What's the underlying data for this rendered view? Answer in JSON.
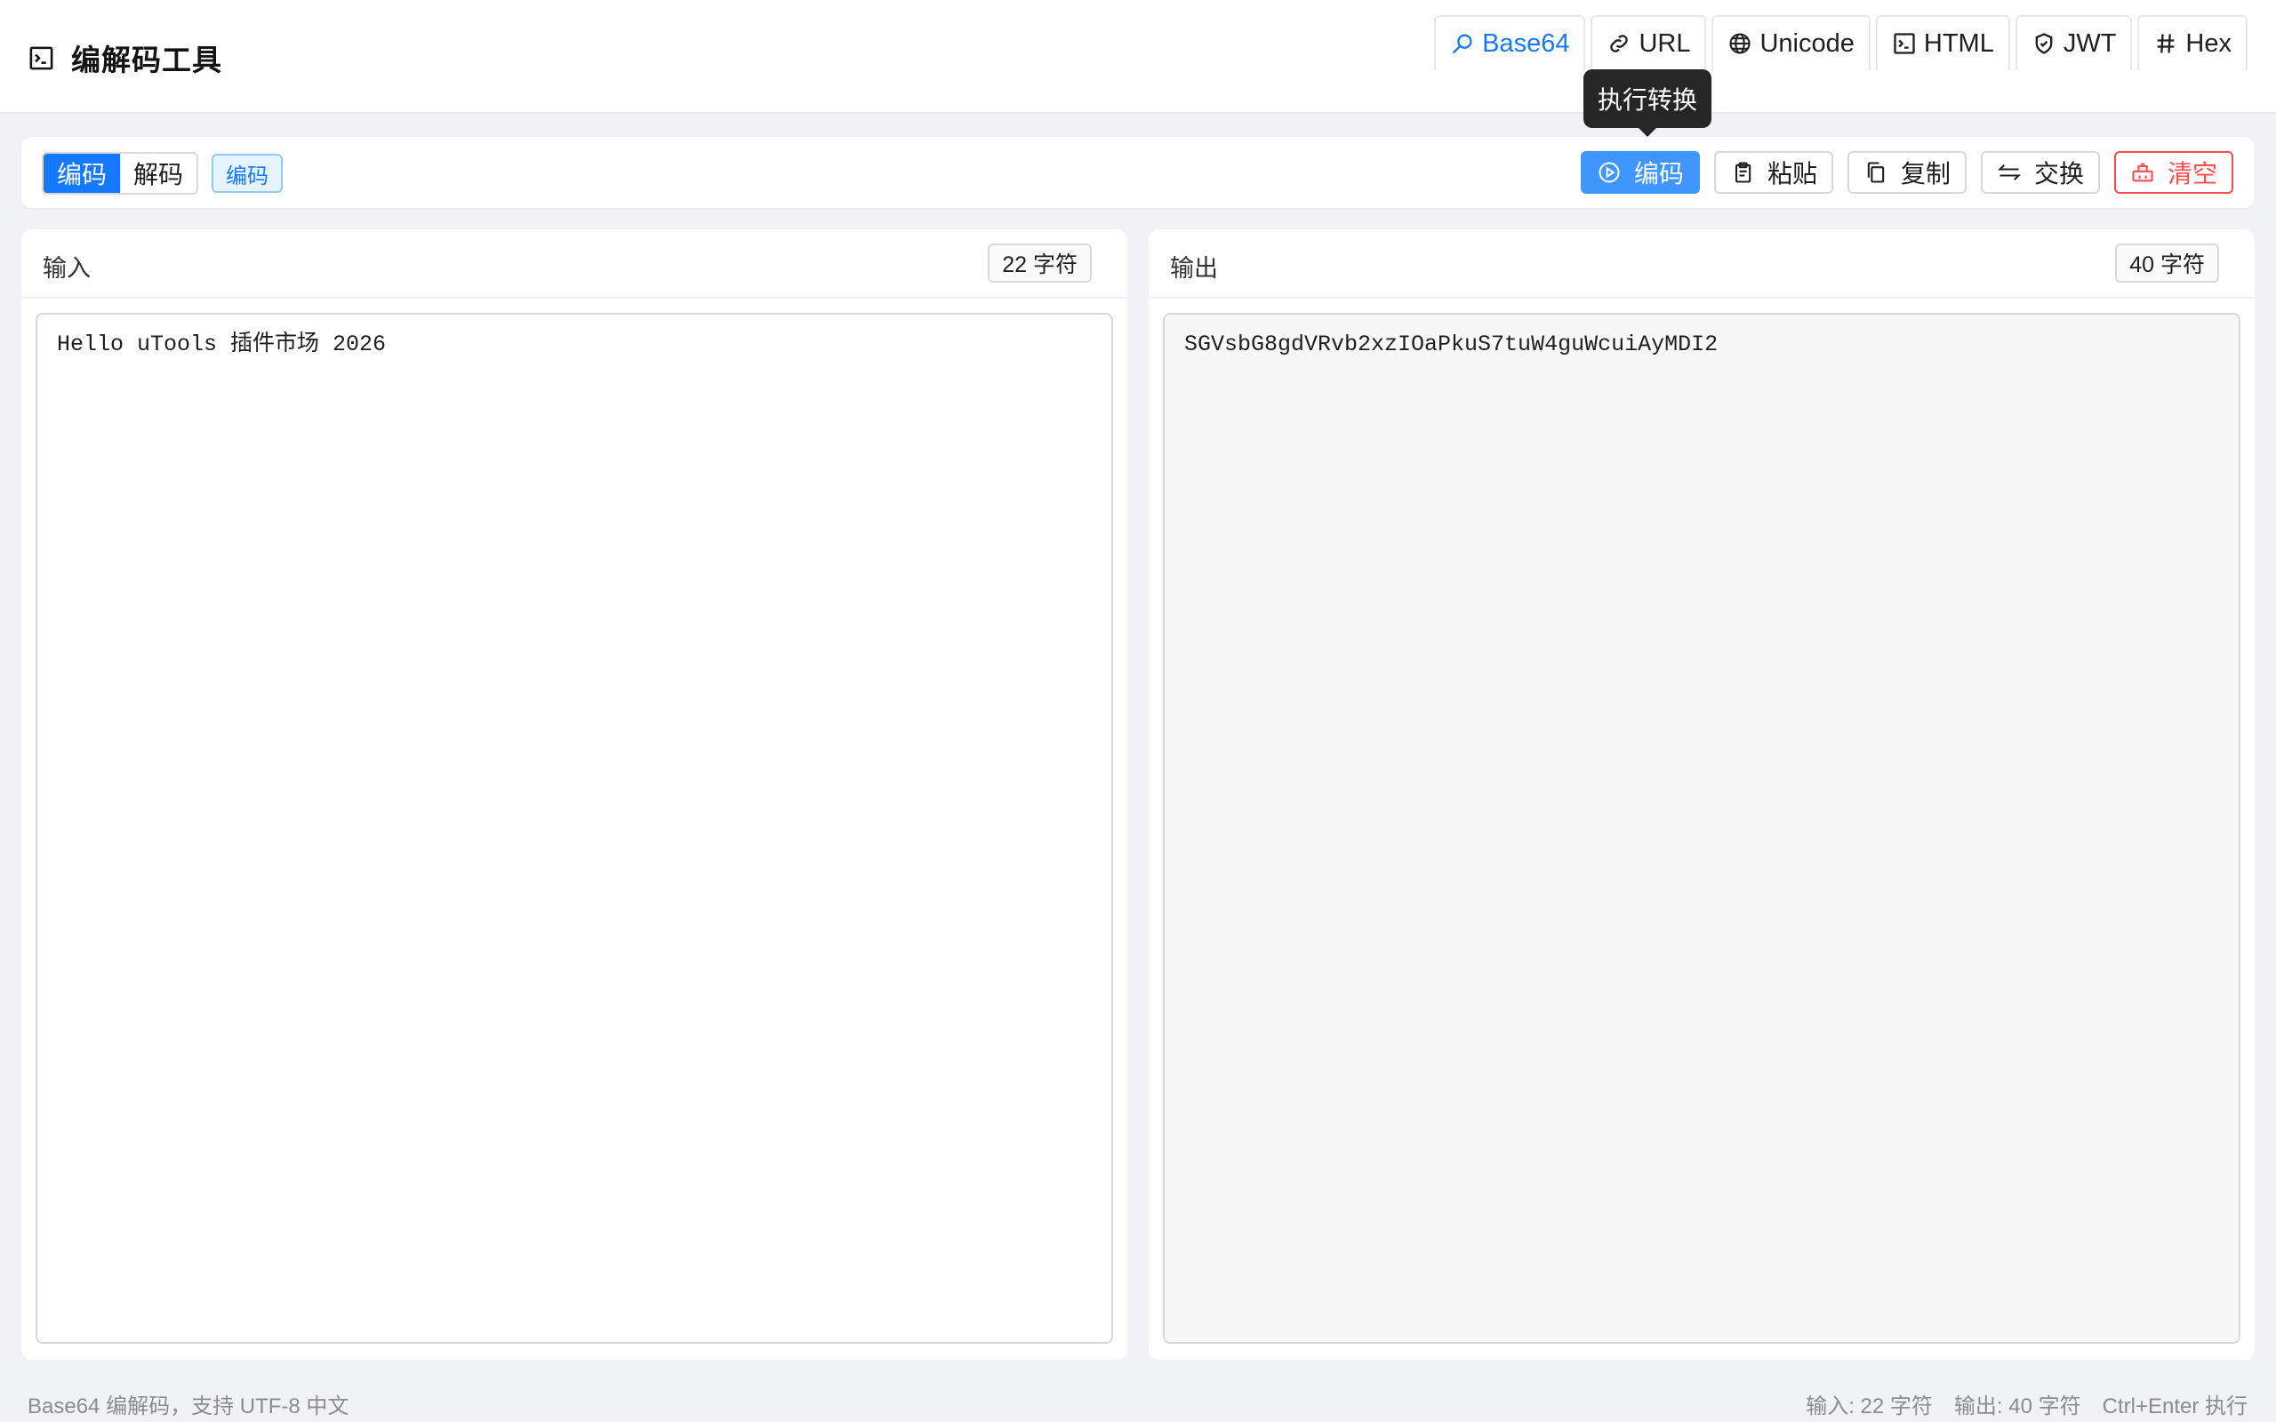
{
  "app": {
    "title": "编解码工具",
    "icon": "terminal-icon"
  },
  "tabs": [
    {
      "label": "Base64",
      "icon": "search-icon",
      "active": true
    },
    {
      "label": "URL",
      "icon": "link-icon",
      "active": false
    },
    {
      "label": "Unicode",
      "icon": "globe-icon",
      "active": false
    },
    {
      "label": "HTML",
      "icon": "code-icon",
      "active": false
    },
    {
      "label": "JWT",
      "icon": "shield-icon",
      "active": false
    },
    {
      "label": "Hex",
      "icon": "hash-icon",
      "active": false
    }
  ],
  "toolbar": {
    "segments": [
      {
        "label": "编码",
        "active": true
      },
      {
        "label": "解码",
        "active": false
      }
    ],
    "mode_tag": "编码",
    "actions": {
      "run": {
        "label": "编码",
        "icon": "play-circle-icon"
      },
      "paste": {
        "label": "粘贴",
        "icon": "clipboard-icon"
      },
      "copy": {
        "label": "复制",
        "icon": "copy-icon"
      },
      "swap": {
        "label": "交换",
        "icon": "swap-icon"
      },
      "clear": {
        "label": "清空",
        "icon": "eraser-icon"
      }
    },
    "tooltip": "执行转换"
  },
  "input_panel": {
    "title": "输入",
    "count": "22 字符",
    "value": "Hello uTools 插件市场 2026"
  },
  "output_panel": {
    "title": "输出",
    "count": "40 字符",
    "value": "SGVsbG8gdVRvb2xzIOaPkuS7tuW4guWcuiAyMDI2"
  },
  "footer": {
    "description": "Base64 编解码，支持 UTF-8 中文",
    "input_stat": "输入: 22 字符",
    "output_stat": "输出: 40 字符",
    "shortcut": "Ctrl+Enter 执行"
  },
  "colors": {
    "primary": "#1677ff",
    "primary_button": "#4096ff",
    "danger": "#ff4d4f",
    "background": "#f0f2f5"
  }
}
